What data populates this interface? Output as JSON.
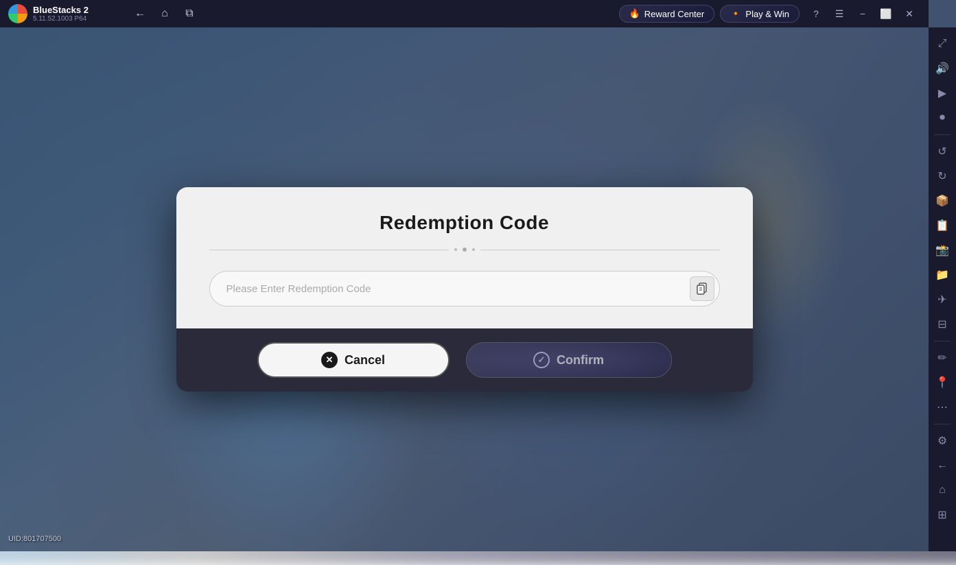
{
  "app": {
    "name": "BlueStacks 2",
    "version": "5.11.52.1003  P64"
  },
  "topbar": {
    "back_label": "←",
    "home_label": "⌂",
    "multi_label": "⧉",
    "reward_center_label": "Reward Center",
    "play_win_label": "Play & Win",
    "help_label": "?",
    "menu_label": "☰",
    "minimize_label": "−",
    "restore_label": "⬜",
    "close_label": "✕",
    "expand_label": "⤢"
  },
  "sidebar": {
    "icons": [
      "⤢",
      "🔊",
      "▶",
      "⏺",
      "↺",
      "↻",
      "📦",
      "📋",
      "📸",
      "📁",
      "✈",
      "⊟",
      "✏",
      "📍",
      "⋯",
      "⚙",
      "←",
      "⌂",
      "📋"
    ]
  },
  "uid": {
    "label": "UID:801707500"
  },
  "dialog": {
    "title": "Redemption Code",
    "input_placeholder": "Please Enter Redemption Code",
    "cancel_label": "Cancel",
    "confirm_label": "Confirm"
  }
}
